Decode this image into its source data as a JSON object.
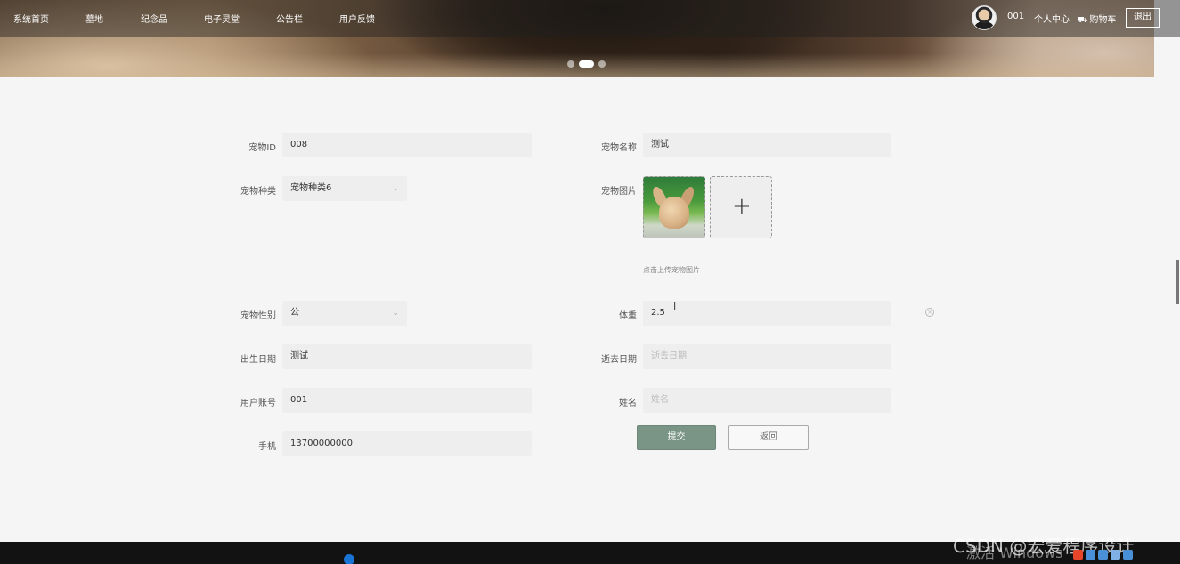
{
  "nav": {
    "items": [
      "系统首页",
      "墓地",
      "纪念品",
      "电子灵堂",
      "公告栏",
      "用户反馈"
    ],
    "user_name": "001",
    "profile_label": "个人中心",
    "cart_label": "购物车",
    "logout_label": "退出"
  },
  "banner": {
    "active_slide": 2,
    "slide_count": 3
  },
  "form": {
    "pet_id": {
      "label": "宠物ID",
      "value": "008"
    },
    "pet_name": {
      "label": "宠物名称",
      "value": "测试"
    },
    "pet_type": {
      "label": "宠物种类",
      "value": "宠物种类6"
    },
    "pet_image": {
      "label": "宠物图片",
      "hint": "点击上传宠物图片"
    },
    "pet_gender": {
      "label": "宠物性别",
      "value": "公"
    },
    "weight": {
      "label": "体重",
      "value": "2.5"
    },
    "birth_date": {
      "label": "出生日期",
      "value": "测试"
    },
    "death_date": {
      "label": "逝去日期",
      "placeholder": "逝去日期"
    },
    "user_account": {
      "label": "用户账号",
      "value": "001"
    },
    "name": {
      "label": "姓名",
      "placeholder": "姓名"
    },
    "phone": {
      "label": "手机",
      "value": "13700000000"
    }
  },
  "buttons": {
    "submit": "提交",
    "back": "返回"
  },
  "watermark": "CSDN @宏爱程序设计",
  "activate_text": "激活 Windows",
  "colors": {
    "primary_button": "#7a9485",
    "field_bg": "#eeeeee",
    "page_bg": "#f5f5f5"
  }
}
